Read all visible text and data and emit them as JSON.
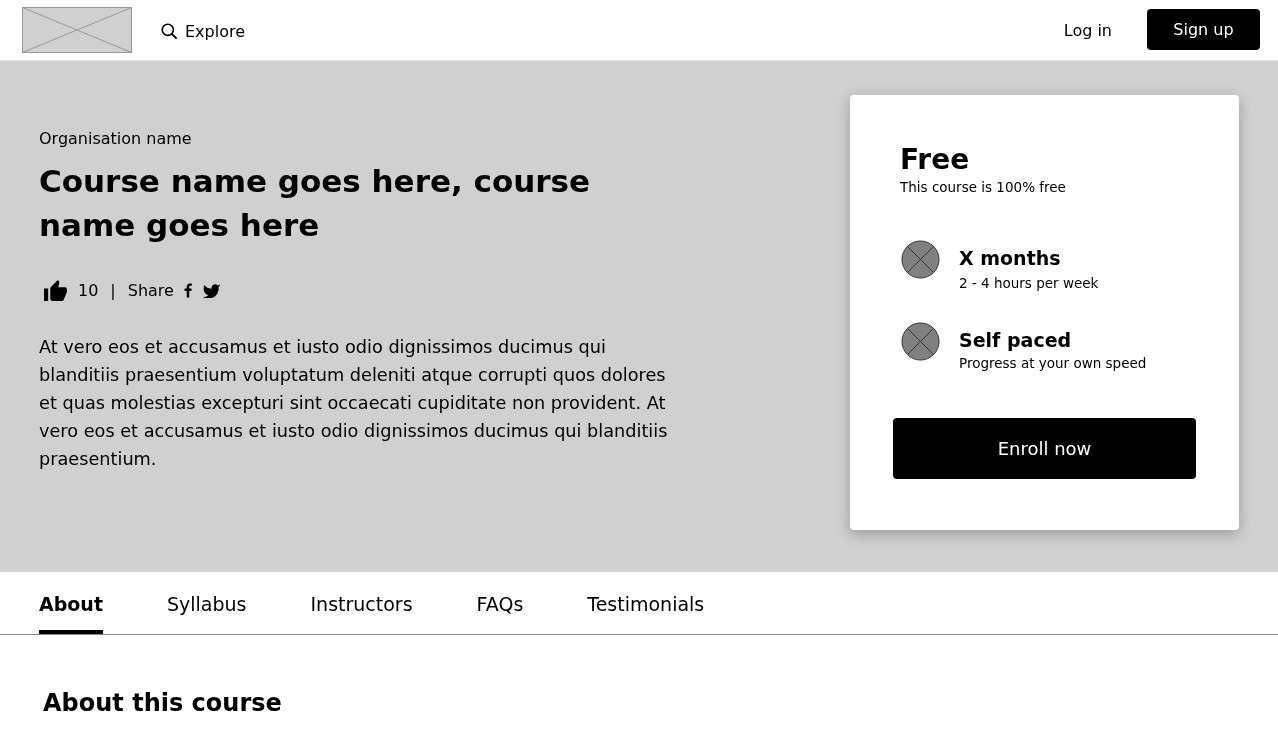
{
  "header": {
    "nav_link": "Explore",
    "login": "Log in",
    "signup": "Sign up"
  },
  "hero": {
    "organisation": "Organisation name",
    "title": "Course name goes here, course name goes here",
    "likes": "10",
    "separator": "|",
    "share_label": "Share",
    "description": "At vero eos et accusamus et iusto odio dignissimos ducimus qui blanditiis praesentium voluptatum deleniti atque corrupti quos dolores et quas molestias excepturi sint occaecati cupiditate non provident. At vero eos et accusamus et iusto odio dignissimos ducimus qui blanditiis praesentium."
  },
  "card": {
    "price": "Free",
    "price_note": "This course is 100% free",
    "features": [
      {
        "title": "X months",
        "subtitle": "2 - 4 hours per week"
      },
      {
        "title": "Self paced",
        "subtitle": "Progress at your own speed"
      }
    ],
    "enroll": "Enroll now"
  },
  "tabs": [
    {
      "label": "About",
      "selected": true
    },
    {
      "label": "Syllabus",
      "selected": false
    },
    {
      "label": "Instructors",
      "selected": false
    },
    {
      "label": "FAQs",
      "selected": false
    },
    {
      "label": "Testimonials",
      "selected": false
    }
  ],
  "section": {
    "heading": "About this course"
  }
}
